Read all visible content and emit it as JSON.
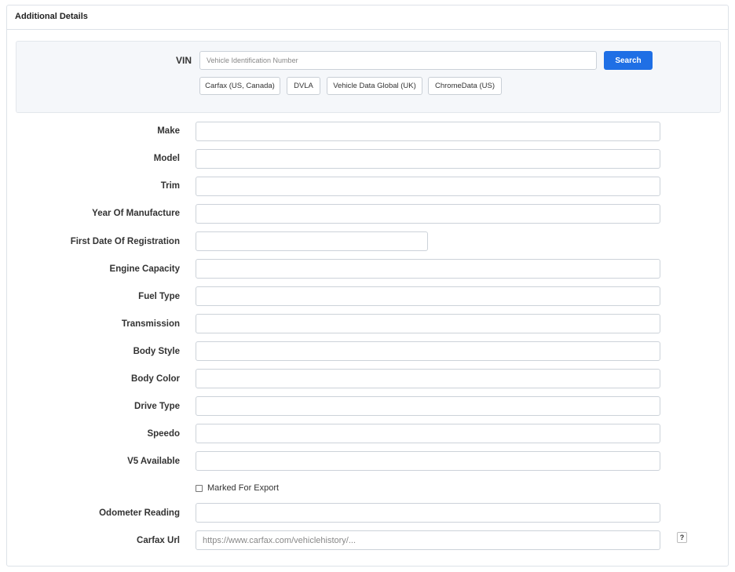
{
  "panel": {
    "title": "Additional Details"
  },
  "vin": {
    "label": "VIN",
    "placeholder": "Vehicle Identification Number",
    "search_label": "Search",
    "providers": [
      "Carfax (US, Canada)",
      "DVLA",
      "Vehicle Data Global (UK)",
      "ChromeData (US)"
    ]
  },
  "fields": {
    "make": "Make",
    "model": "Model",
    "trim": "Trim",
    "year": "Year Of Manufacture",
    "first_reg": "First Date Of Registration",
    "engine": "Engine Capacity",
    "fuel": "Fuel Type",
    "transmission": "Transmission",
    "body_style": "Body Style",
    "body_color": "Body Color",
    "drive_type": "Drive Type",
    "speedo": "Speedo",
    "v5": "V5 Available",
    "odometer": "Odometer Reading",
    "carfax_url": "Carfax Url"
  },
  "export": {
    "label": "Marked For Export",
    "checked": false
  },
  "carfax": {
    "placeholder": "https://www.carfax.com/vehiclehistory/...",
    "help": "?"
  }
}
